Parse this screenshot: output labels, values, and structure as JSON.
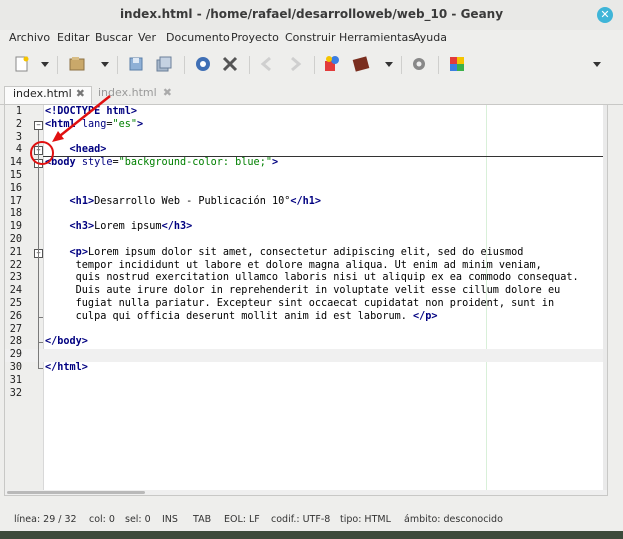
{
  "window": {
    "title": "index.html - /home/rafael/desarrolloweb/web_10 - Geany",
    "close_glyph": "✕"
  },
  "menu": [
    "Archivo",
    "Editar",
    "Buscar",
    "Ver",
    "Documento",
    "Proyecto",
    "Construir",
    "Herramientas",
    "Ayuda"
  ],
  "toolbar": {
    "icons": [
      "new-file-icon",
      "dropdown-arrow-icon",
      "open-file-icon",
      "dropdown-arrow-icon",
      "save-icon",
      "save-all-icon",
      "reload-icon",
      "close-file-icon",
      "back-arrow-icon",
      "forward-arrow-icon",
      "compile-icon",
      "build-icon",
      "dropdown-arrow-icon",
      "preferences-icon",
      "color-chooser-icon",
      "overflow-arrow-icon"
    ]
  },
  "tabs": [
    {
      "label": "index.html",
      "close": "✖",
      "active": true
    },
    {
      "label": "index.html",
      "close": "✖",
      "active": false
    }
  ],
  "editor": {
    "lines": [
      {
        "n": "1",
        "segs": [
          [
            "tag",
            "<!DOCTYPE "
          ],
          [
            "tag",
            "html"
          ],
          [
            "tag",
            ">"
          ]
        ]
      },
      {
        "n": "2",
        "segs": [
          [
            "tag",
            "<html "
          ],
          [
            "attr",
            "lang"
          ],
          [
            "text",
            "="
          ],
          [
            "str",
            "\"es\""
          ],
          [
            "tag",
            ">"
          ]
        ]
      },
      {
        "n": "3",
        "segs": []
      },
      {
        "n": "4",
        "segs": [
          [
            "text",
            "    "
          ],
          [
            "tag",
            "<head>"
          ]
        ]
      },
      {
        "n": "14",
        "segs": [
          [
            "tag",
            "<body "
          ],
          [
            "attr",
            "style"
          ],
          [
            "text",
            "="
          ],
          [
            "str",
            "\"background-color: blue;\""
          ],
          [
            "tag",
            ">"
          ]
        ]
      },
      {
        "n": "15",
        "segs": []
      },
      {
        "n": "16",
        "segs": []
      },
      {
        "n": "17",
        "segs": [
          [
            "text",
            "    "
          ],
          [
            "tag",
            "<h1>"
          ],
          [
            "text",
            "Desarrollo Web - Publicación 10°"
          ],
          [
            "tag",
            "</h1>"
          ]
        ]
      },
      {
        "n": "18",
        "segs": []
      },
      {
        "n": "19",
        "segs": [
          [
            "text",
            "    "
          ],
          [
            "tag",
            "<h3>"
          ],
          [
            "text",
            "Lorem ipsum"
          ],
          [
            "tag",
            "</h3>"
          ]
        ]
      },
      {
        "n": "20",
        "segs": []
      },
      {
        "n": "21",
        "segs": [
          [
            "text",
            "    "
          ],
          [
            "tag",
            "<p>"
          ],
          [
            "text",
            "Lorem ipsum dolor sit amet, consectetur adipiscing elit, sed do eiusmod"
          ]
        ]
      },
      {
        "n": "22",
        "segs": [
          [
            "text",
            "     tempor incididunt ut labore et dolore magna aliqua. Ut enim ad minim veniam,"
          ]
        ]
      },
      {
        "n": "23",
        "segs": [
          [
            "text",
            "     quis nostrud exercitation ullamco laboris nisi ut aliquip ex ea commodo consequat."
          ]
        ]
      },
      {
        "n": "24",
        "segs": [
          [
            "text",
            "     Duis aute irure dolor in reprehenderit in voluptate velit esse cillum dolore eu"
          ]
        ]
      },
      {
        "n": "25",
        "segs": [
          [
            "text",
            "     fugiat nulla pariatur. Excepteur sint occaecat cupidatat non proident, sunt in"
          ]
        ]
      },
      {
        "n": "26",
        "segs": [
          [
            "text",
            "     culpa qui officia deserunt mollit anim id est laborum. "
          ],
          [
            "tag",
            "</p>"
          ]
        ]
      },
      {
        "n": "27",
        "segs": []
      },
      {
        "n": "28",
        "segs": [
          [
            "tag",
            "</body>"
          ]
        ]
      },
      {
        "n": "29",
        "segs": []
      },
      {
        "n": "30",
        "segs": [
          [
            "tag",
            "</html>"
          ]
        ]
      },
      {
        "n": "31",
        "segs": []
      },
      {
        "n": "32",
        "segs": []
      }
    ],
    "fold_plus": "+",
    "fold_minus": "−"
  },
  "status": {
    "line": "línea: 29 / 32",
    "col": "col: 0",
    "sel": "sel: 0",
    "ins": "INS",
    "tab": "TAB",
    "eol": "EOL: LF",
    "encoding": "codif.: UTF-8",
    "type": "tipo: HTML",
    "scope": "ámbito: desconocido"
  },
  "colors": {
    "tag": "#000080",
    "string": "#008000",
    "annotation": "#e01010"
  }
}
